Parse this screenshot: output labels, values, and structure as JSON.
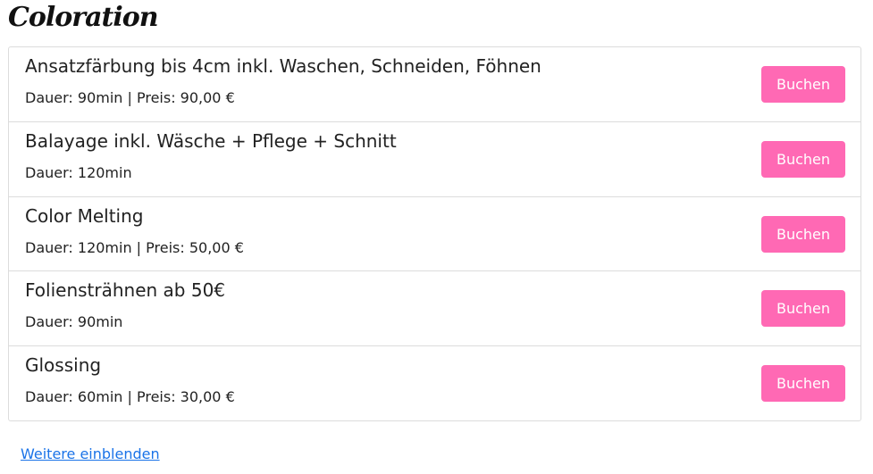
{
  "section": {
    "title": "Coloration"
  },
  "services": [
    {
      "name": "Ansatzfärbung bis 4cm inkl. Waschen, Schneiden, Föhnen",
      "meta": "Dauer: 90min | Preis: 90,00 €",
      "button": "Buchen"
    },
    {
      "name": "Balayage inkl. Wäsche + Pflege + Schnitt",
      "meta": "Dauer: 120min",
      "button": "Buchen"
    },
    {
      "name": "Color Melting",
      "meta": "Dauer: 120min | Preis: 50,00 €",
      "button": "Buchen"
    },
    {
      "name": "Foliensträhnen ab 50€",
      "meta": "Dauer: 90min",
      "button": "Buchen"
    },
    {
      "name": "Glossing",
      "meta": "Dauer: 60min | Preis: 30,00 €",
      "button": "Buchen"
    }
  ],
  "more_link": "Weitere einblenden",
  "colors": {
    "accent": "#ff69b4",
    "link": "#1a73e8",
    "border": "#dcdcdc"
  }
}
